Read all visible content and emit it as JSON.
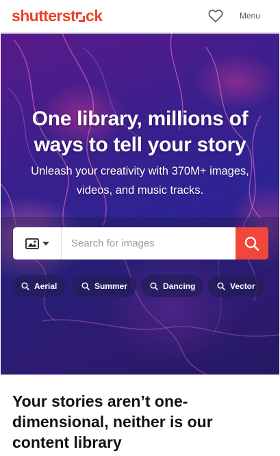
{
  "header": {
    "logo": {
      "part1": "shutterst",
      "part2": "ck"
    },
    "favorites_icon": "heart-icon",
    "menu_label": "Menu"
  },
  "hero": {
    "title_line1": "One library, millions of",
    "title_line2": "ways to tell your story",
    "subtitle_line1": "Unleash your creativity with 370M+ images,",
    "subtitle_line2": "videos, and music tracks."
  },
  "search": {
    "type_icon": "image-icon",
    "placeholder": "Search for images",
    "value": "",
    "button_icon": "search-icon"
  },
  "chips": [
    {
      "label": "Aerial"
    },
    {
      "label": "Summer"
    },
    {
      "label": "Dancing"
    },
    {
      "label": "Vector"
    }
  ],
  "section": {
    "title": "Your stories aren’t one-dimensional, neither is our content library"
  },
  "colors": {
    "brand": "#e8432b",
    "search_button": "#f0473a",
    "hero_base": "#2d2393"
  }
}
